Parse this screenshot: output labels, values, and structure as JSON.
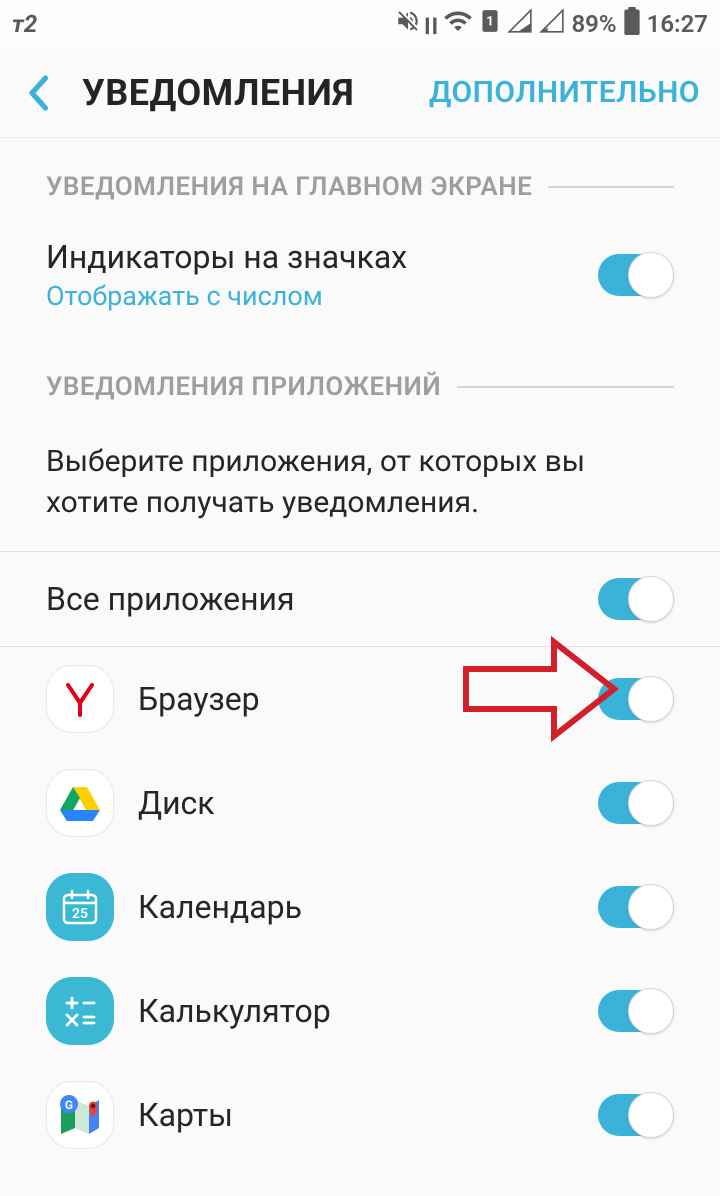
{
  "status": {
    "carrier": "т2",
    "battery": "89%",
    "time": "16:27"
  },
  "header": {
    "title": "УВЕДОМЛЕНИЯ",
    "advanced": "ДОПОЛНИТЕЛЬНО"
  },
  "section1": {
    "header": "УВЕДОМЛЕНИЯ НА ГЛАВНОМ ЭКРАНЕ",
    "badge_title": "Индикаторы на значках",
    "badge_subtitle": "Отображать с числом"
  },
  "section2": {
    "header": "УВЕДОМЛЕНИЯ ПРИЛОЖЕНИЙ",
    "description": "Выберите приложения, от которых вы хотите получать уведомления.",
    "all_apps": "Все приложения"
  },
  "apps": [
    {
      "name": "Браузер",
      "icon": "yandex"
    },
    {
      "name": "Диск",
      "icon": "drive"
    },
    {
      "name": "Календарь",
      "icon": "calendar"
    },
    {
      "name": "Калькулятор",
      "icon": "calc"
    },
    {
      "name": "Карты",
      "icon": "maps"
    }
  ]
}
